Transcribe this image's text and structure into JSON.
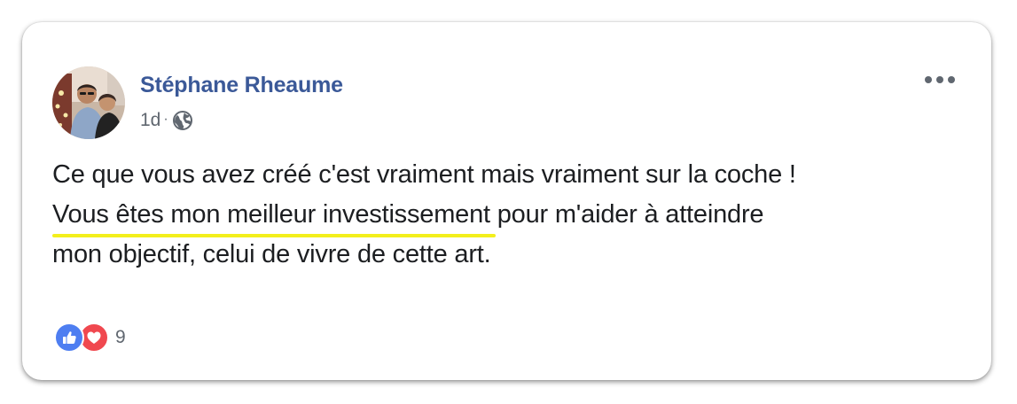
{
  "post": {
    "author": "Stéphane Rheaume",
    "time": "1d",
    "separator": "·",
    "privacy_icon": "globe-icon",
    "more_icon": "more-options-icon",
    "text": {
      "line1": "Ce que vous avez créé c'est vraiment mais vraiment sur la coche !",
      "line2_highlight": "Vous êtes mon meilleur investissement",
      "line2_rest": " pour m'aider à atteindre",
      "line3": "mon objectif, celui de vivre de cette art."
    },
    "reactions": {
      "icons": [
        "like-icon",
        "love-icon"
      ],
      "count": "9"
    }
  },
  "colors": {
    "author": "#3b5998",
    "meta": "#606770",
    "text": "#1c1e21",
    "highlight_underline": "#f3ef1c",
    "like": "#4e7ef1",
    "love": "#f0484f"
  }
}
